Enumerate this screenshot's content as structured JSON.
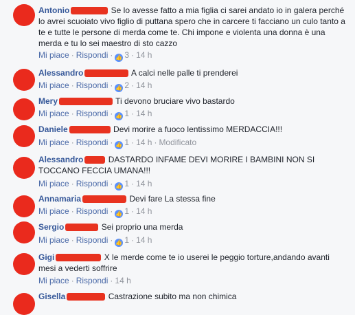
{
  "ui": {
    "like_label": "Mi piace",
    "reply_label": "Rispondi",
    "separator": "·",
    "like_icon_glyph": "👍"
  },
  "colors": {
    "name": "#365899",
    "meta": "#90949c",
    "redaction": "#e8321f",
    "like_badge": "#5890ff"
  },
  "comments": [
    {
      "name": "Antonio",
      "text": "Se lo avesse fatto a mia figlia ci sarei andato io in galera perché lo avrei scuoiato vivo figlio di puttana spero che in carcere ti facciano un culo tanto a te e tutte le persone di merda come te. Chi impone e violenta una donna è una merda e tu lo sei maestro di sto cazzo",
      "likes": "3",
      "time": "14 h",
      "extra": ""
    },
    {
      "name": "Alessandro",
      "text": "A calci nelle palle ti prenderei",
      "likes": "2",
      "time": "14 h",
      "extra": ""
    },
    {
      "name": "Mery",
      "text": "Ti devono bruciare vivo bastardo",
      "likes": "1",
      "time": "14 h",
      "extra": ""
    },
    {
      "name": "Daniele",
      "text": "Devi morire a fuoco lentissimo MERDACCIA!!!",
      "likes": "1",
      "time": "14 h",
      "extra": "Modificato"
    },
    {
      "name": "Alessandro",
      "text": "DASTARDO INFAME DEVI MORIRE I BAMBINI NON SI TOCCANO FECCIA UMANA!!!",
      "likes": "1",
      "time": "14 h",
      "extra": ""
    },
    {
      "name": "Annamaria",
      "text": "Devi fare La stessa fine",
      "likes": "1",
      "time": "14 h",
      "extra": ""
    },
    {
      "name": "Sergio",
      "text": "Sei proprio una merda",
      "likes": "1",
      "time": "14 h",
      "extra": ""
    },
    {
      "name": "Gigi",
      "text": "X le merde come te io userei le peggio torture,andando avanti mesi a vederti soffrire",
      "likes": "",
      "time": "14 h",
      "extra": ""
    },
    {
      "name": "Gisella",
      "text": "Castrazione subito ma non chimica",
      "likes": "",
      "time": "",
      "extra": ""
    }
  ]
}
